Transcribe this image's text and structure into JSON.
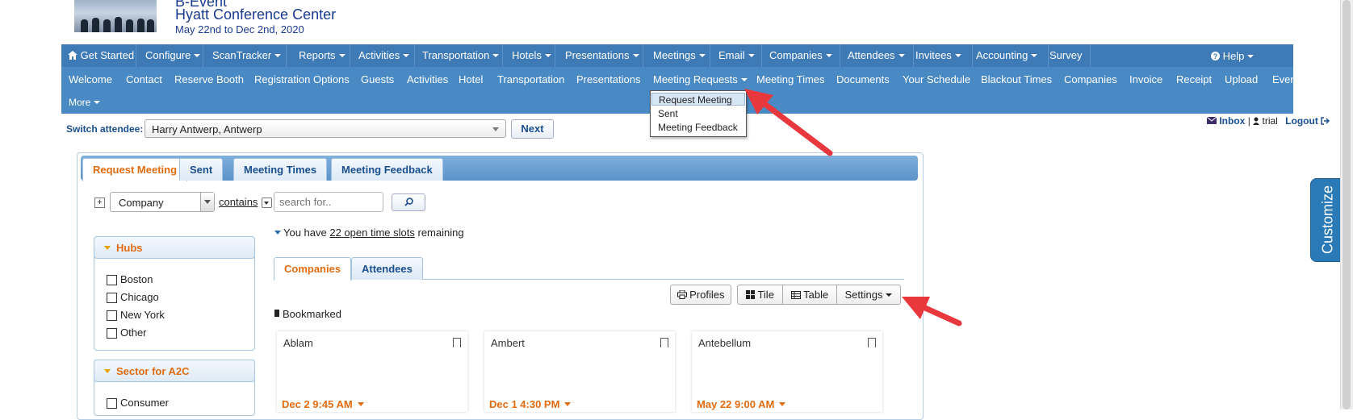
{
  "header": {
    "event_name": "B-Event",
    "venue": "Hyatt Conference Center",
    "dates": "May 22nd to Dec 2nd, 2020"
  },
  "topnav": {
    "items": [
      "Get Started",
      "Configure",
      "ScanTracker",
      "Reports",
      "Activities",
      "Transportation",
      "Hotels",
      "Presentations",
      "Meetings",
      "Email",
      "Companies",
      "Attendees",
      "Invitees",
      "Accounting",
      "Survey"
    ],
    "help": "Help"
  },
  "subnav": {
    "items": [
      "Welcome",
      "Contact",
      "Reserve Booth",
      "Registration Options",
      "Guests",
      "Activities",
      "Hotel",
      "Transportation",
      "Presentations",
      "Meeting Requests",
      "Meeting Times",
      "Documents",
      "Your Schedule",
      "Blackout Times",
      "Companies",
      "Invoice",
      "Receipt",
      "Upload",
      "Event List"
    ],
    "more": "More"
  },
  "dropdown": {
    "items": [
      "Request Meeting",
      "Sent",
      "Meeting Feedback"
    ]
  },
  "switch_attendee": {
    "label": "Switch attendee:",
    "value": "Harry Antwerp, Antwerp",
    "next": "Next"
  },
  "user_bar": {
    "inbox": "Inbox",
    "user": "trial",
    "logout": "Logout"
  },
  "tabs": [
    "Request Meeting",
    "Sent",
    "Meeting Times",
    "Meeting Feedback"
  ],
  "filter": {
    "plus": "+",
    "field": "Company",
    "operator": "contains",
    "placeholder": "search for.."
  },
  "facets": [
    {
      "title": "Hubs",
      "options": [
        "Boston",
        "Chicago",
        "New York",
        "Other"
      ]
    },
    {
      "title": "Sector for A2C",
      "options": [
        "Consumer"
      ]
    }
  ],
  "slots": {
    "prefix": "You have ",
    "link": "22 open time slots",
    "suffix": " remaining"
  },
  "subtabs": [
    "Companies",
    "Attendees"
  ],
  "toolbar": {
    "profiles": "Profiles",
    "tile": "Tile",
    "table": "Table",
    "settings": "Settings"
  },
  "bookmarked_label": "Bookmarked",
  "cards": [
    {
      "name": "Ablam",
      "time": "Dec 2 9:45 AM"
    },
    {
      "name": "Ambert",
      "time": "Dec 1 4:30 PM"
    },
    {
      "name": "Antebellum",
      "time": "May 22 9:00 AM"
    }
  ],
  "customize": "Customize",
  "colors": {
    "nav_dark": "#3e7bb6",
    "nav_light": "#4a8ac4",
    "accent_orange": "#e16c10",
    "link_blue": "#1a4f8f",
    "annotation_red": "#e8383d"
  }
}
